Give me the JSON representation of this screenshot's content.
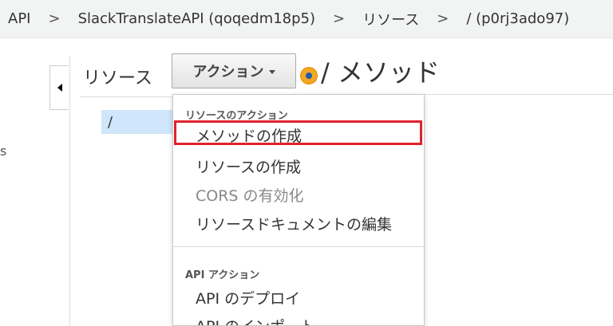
{
  "breadcrumb": {
    "items": [
      "API",
      "SlackTranslateAPI (qoqedm18p5)",
      "リソース",
      "/ (p0rj3ado97)"
    ],
    "separator": ">"
  },
  "left_edge_text": "s",
  "resources_panel": {
    "label": "リソース",
    "action_button": "アクション",
    "tree": [
      {
        "label": "/"
      }
    ]
  },
  "method_title": "/ メソッド",
  "dropdown": {
    "sections": [
      {
        "title": "リソースのアクション",
        "items": [
          {
            "label": "メソッドの作成",
            "enabled": true,
            "highlighted": true
          },
          {
            "label": "リソースの作成",
            "enabled": true
          },
          {
            "label": "CORS の有効化",
            "enabled": false
          },
          {
            "label": "リソースドキュメントの編集",
            "enabled": true
          }
        ]
      },
      {
        "title": "API アクション",
        "items": [
          {
            "label": "API のデプロイ",
            "enabled": true
          },
          {
            "label": "API のインポート",
            "enabled": true
          }
        ]
      }
    ]
  },
  "colors": {
    "highlight_border": "#e0232b",
    "selected_tree_bg": "#cfe6fb",
    "status_dot": "#f5a623"
  }
}
